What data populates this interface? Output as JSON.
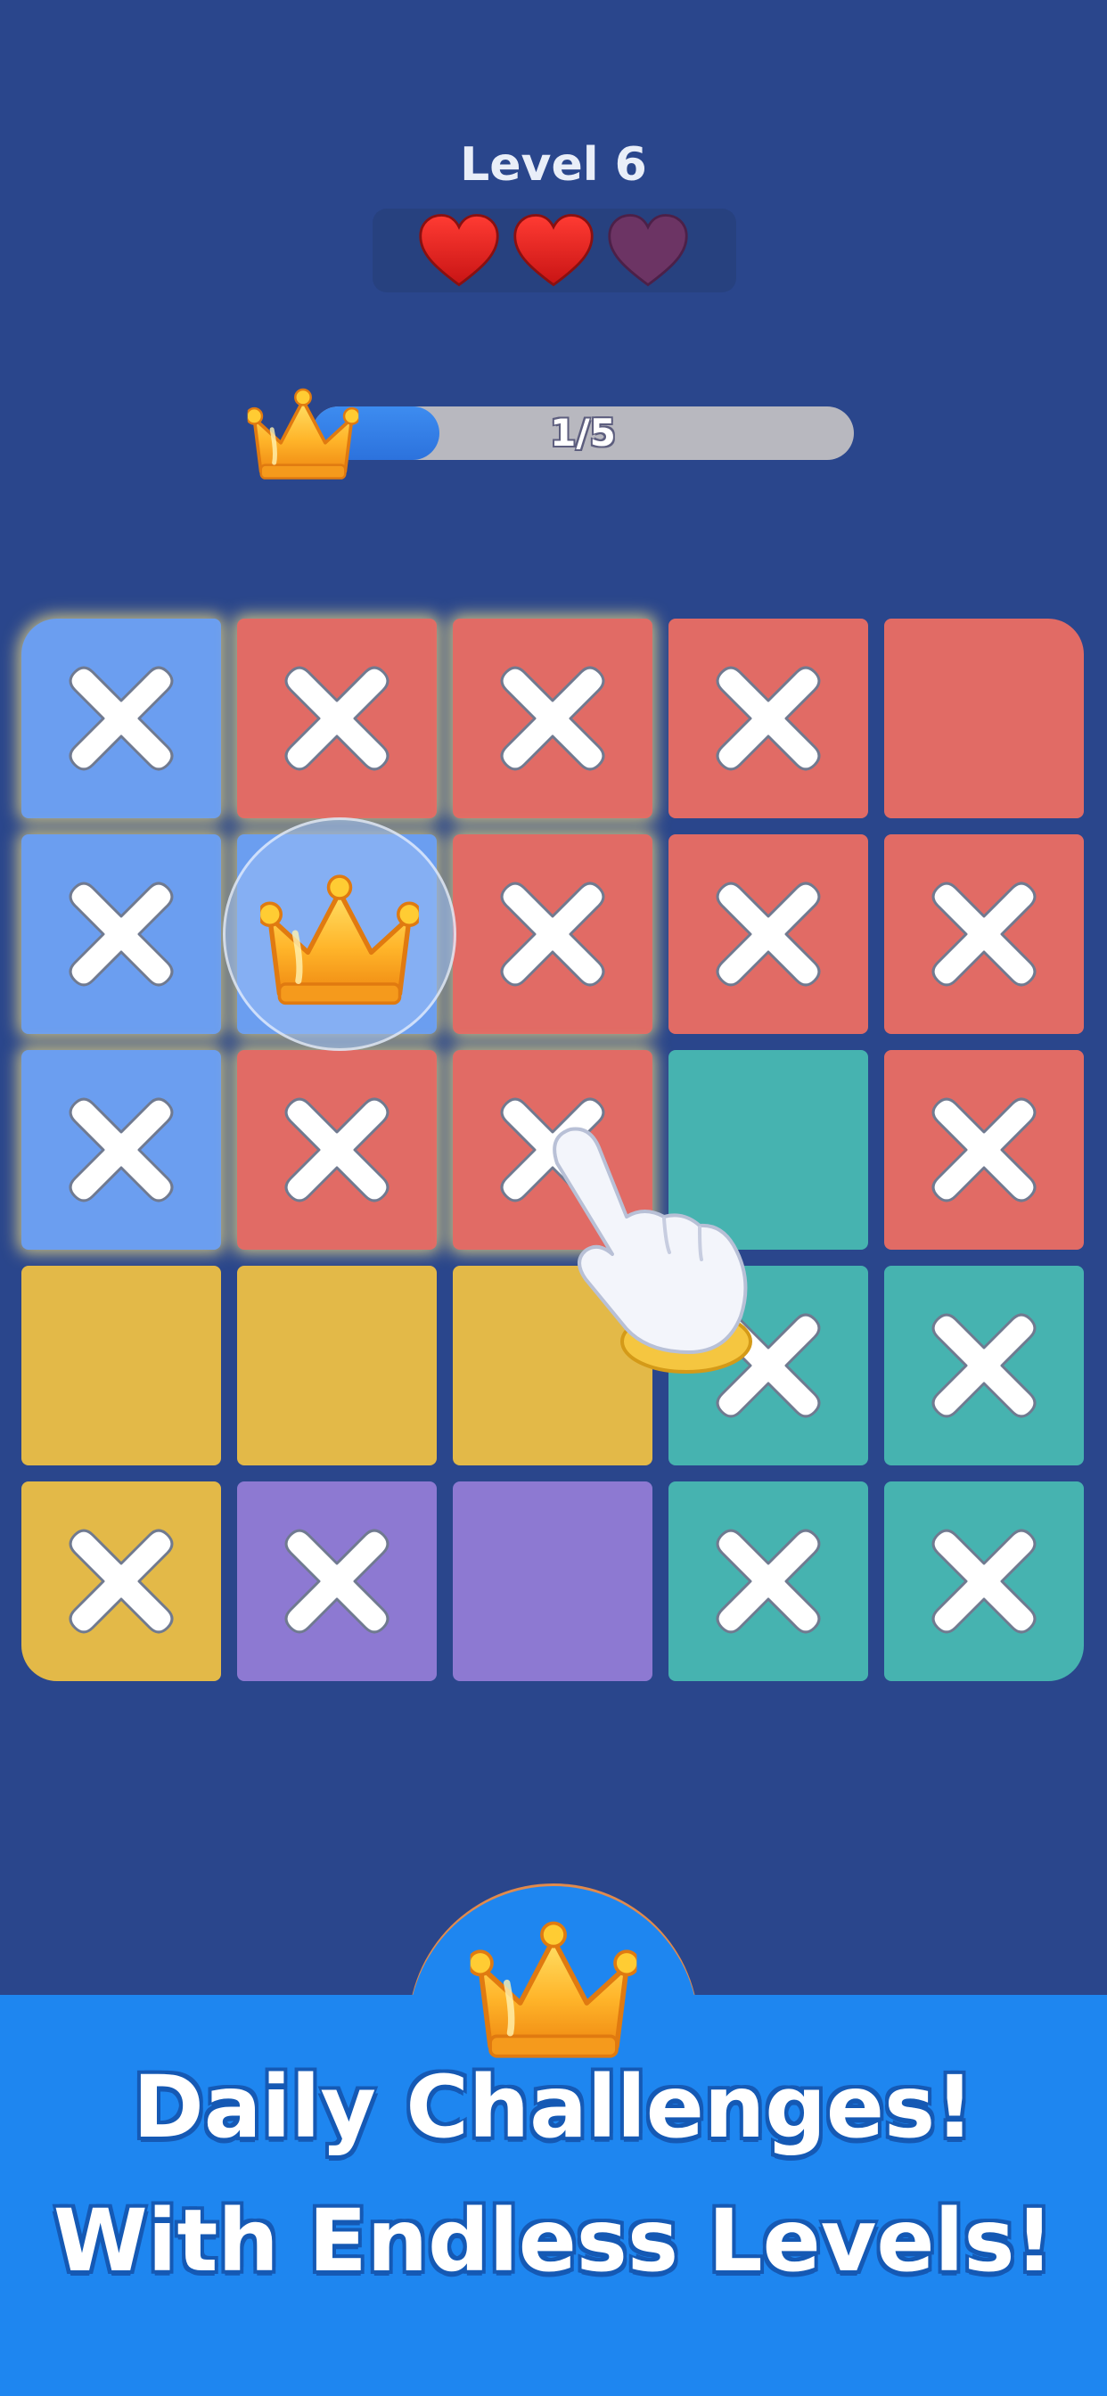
{
  "header": {
    "level_label": "Level 6",
    "lives": [
      {
        "state": "full",
        "color": "#e0221f"
      },
      {
        "state": "full",
        "color": "#e0221f"
      },
      {
        "state": "empty",
        "color": "#6c3464"
      }
    ]
  },
  "progress": {
    "icon": "crown-icon",
    "text": "1/5",
    "current": 1,
    "total": 5
  },
  "colors": {
    "blue": "#6b9ef0",
    "red": "#e16b65",
    "teal": "#46b3b0",
    "yellow": "#e3b948",
    "purple": "#8d79d2",
    "background": "#2a468c",
    "banner": "#1e86f0"
  },
  "board": {
    "rows": 5,
    "cols": 5,
    "cells": [
      [
        {
          "color": "blue",
          "mark": true,
          "glow": true
        },
        {
          "color": "red",
          "mark": true,
          "glow": true
        },
        {
          "color": "red",
          "mark": true,
          "glow": true
        },
        {
          "color": "red",
          "mark": true,
          "glow": false
        },
        {
          "color": "red",
          "mark": false,
          "glow": false
        }
      ],
      [
        {
          "color": "blue",
          "mark": true,
          "glow": true
        },
        {
          "color": "blue",
          "mark": false,
          "glow": true,
          "crown": true
        },
        {
          "color": "red",
          "mark": true,
          "glow": true
        },
        {
          "color": "red",
          "mark": true,
          "glow": false
        },
        {
          "color": "red",
          "mark": true,
          "glow": false
        }
      ],
      [
        {
          "color": "blue",
          "mark": true,
          "glow": true
        },
        {
          "color": "red",
          "mark": true,
          "glow": true
        },
        {
          "color": "red",
          "mark": true,
          "glow": true
        },
        {
          "color": "teal",
          "mark": false,
          "glow": false
        },
        {
          "color": "red",
          "mark": true,
          "glow": false
        }
      ],
      [
        {
          "color": "yellow",
          "mark": false,
          "glow": false
        },
        {
          "color": "yellow",
          "mark": false,
          "glow": false
        },
        {
          "color": "yellow",
          "mark": false,
          "glow": false
        },
        {
          "color": "teal",
          "mark": true,
          "glow": false
        },
        {
          "color": "teal",
          "mark": true,
          "glow": false
        }
      ],
      [
        {
          "color": "yellow",
          "mark": true,
          "glow": false
        },
        {
          "color": "purple",
          "mark": true,
          "glow": false
        },
        {
          "color": "purple",
          "mark": false,
          "glow": false
        },
        {
          "color": "teal",
          "mark": true,
          "glow": false
        },
        {
          "color": "teal",
          "mark": true,
          "glow": false
        }
      ]
    ]
  },
  "banner": {
    "icon": "crown-icon",
    "line1": "Daily Challenges!",
    "line2": "With Endless Levels!"
  }
}
